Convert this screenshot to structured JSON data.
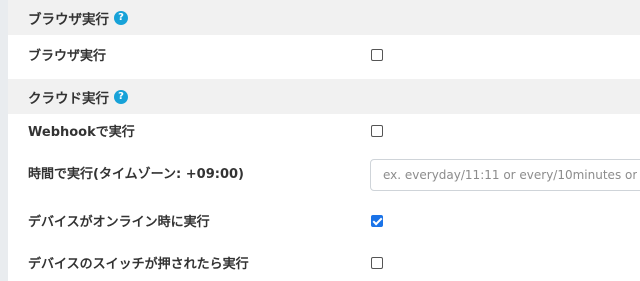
{
  "browser_section": {
    "title": "ブラウザ実行",
    "help_icon": "question-circle-icon",
    "rows": [
      {
        "label": "ブラウザ実行",
        "checked": false
      }
    ]
  },
  "cloud_section": {
    "title": "クラウド実行",
    "help_icon": "question-circle-icon",
    "webhook": {
      "label": "Webhookで実行",
      "checked": false
    },
    "schedule": {
      "label": "時間で実行(タイムゾーン: +09:00)",
      "placeholder": "ex. everyday/11:11 or every/10minutes or",
      "value": ""
    },
    "device_online": {
      "label": "デバイスがオンライン時に実行",
      "checked": true
    },
    "device_switch": {
      "label": "デバイスのスイッチが押されたら実行",
      "checked": false
    }
  },
  "colors": {
    "accent": "#1a73e8",
    "help_icon": "#17a2d8",
    "header_bg": "#f1f1f1"
  },
  "help_glyph": "?"
}
